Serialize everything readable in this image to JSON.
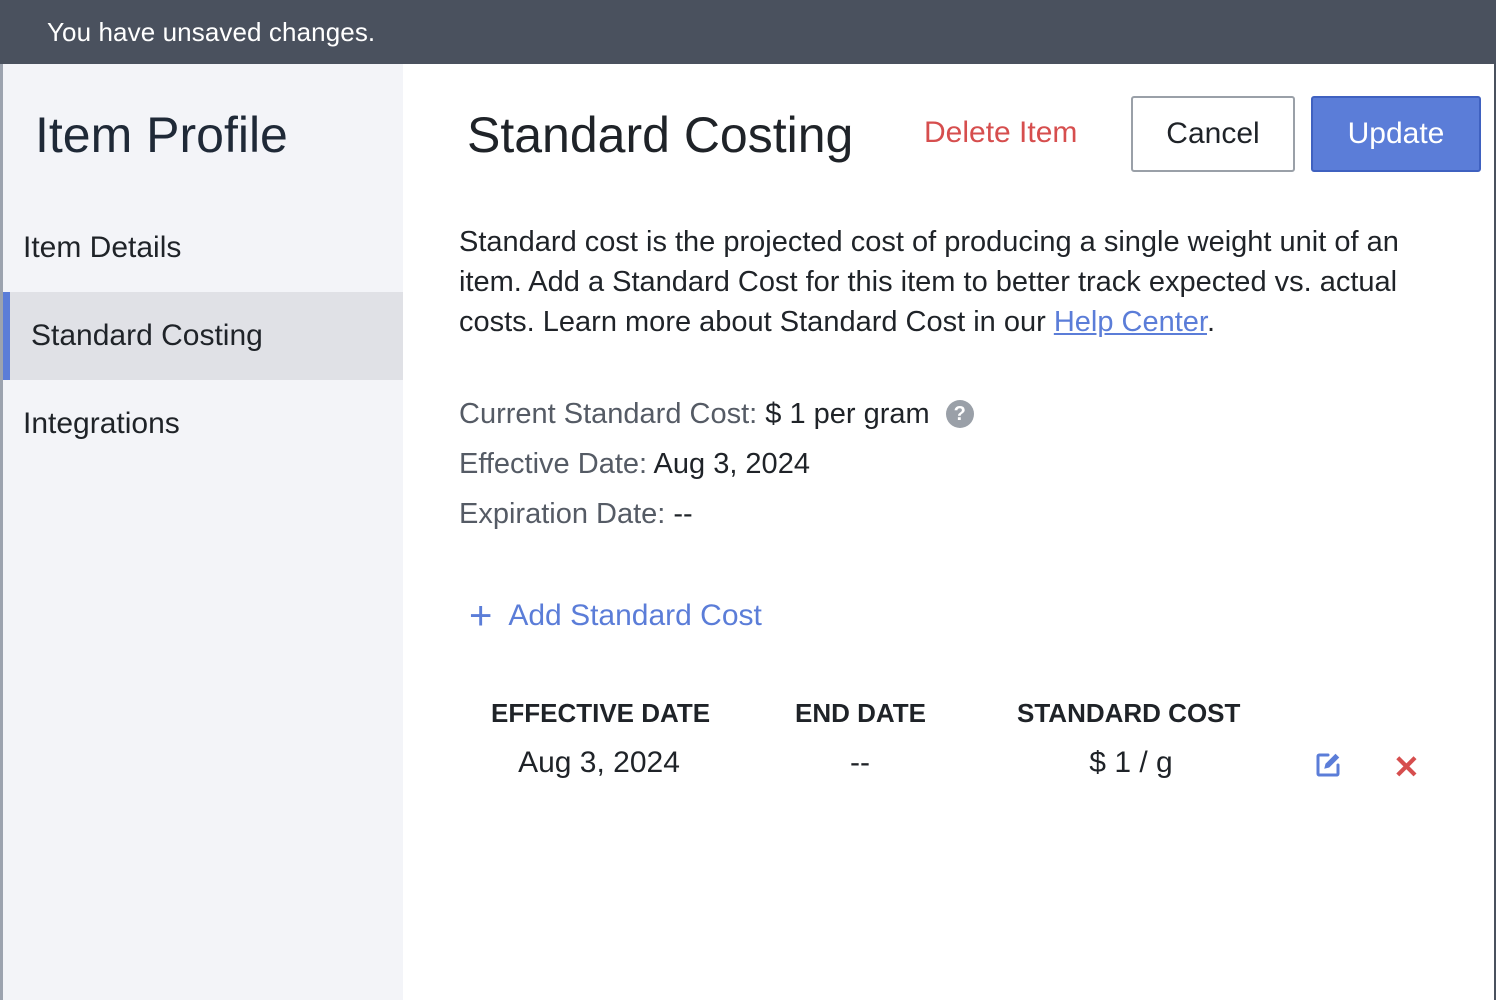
{
  "banner": {
    "message": "You have unsaved changes."
  },
  "sidebar": {
    "title": "Item Profile",
    "items": [
      {
        "label": "Item Details",
        "active": false
      },
      {
        "label": "Standard Costing",
        "active": true
      },
      {
        "label": "Integrations",
        "active": false
      }
    ]
  },
  "header": {
    "title": "Standard Costing",
    "delete_label": "Delete Item",
    "cancel_label": "Cancel",
    "update_label": "Update"
  },
  "description": {
    "text": "Standard cost is the projected cost of producing a single weight unit of an item. Add a Standard Cost for this item to better track expected vs. actual costs. Learn more about Standard Cost in our ",
    "link_text": "Help Center",
    "suffix": "."
  },
  "current": {
    "cost_label": "Current Standard Cost:",
    "cost_value": "$ 1 per gram",
    "effective_label": "Effective Date:",
    "effective_value": "Aug 3, 2024",
    "expiration_label": "Expiration Date:",
    "expiration_value": "--",
    "help_icon": "?"
  },
  "add_cost": {
    "icon": "+",
    "label": "Add Standard Cost"
  },
  "table": {
    "columns": [
      "EFFECTIVE DATE",
      "END DATE",
      "STANDARD COST"
    ],
    "rows": [
      {
        "effective_date": "Aug 3, 2024",
        "end_date": "--",
        "standard_cost": "$ 1 / g"
      }
    ]
  },
  "colors": {
    "accent": "#5b7dd8",
    "danger": "#d64e4e",
    "banner_bg": "#4a515e",
    "sidebar_bg": "#f3f4f8",
    "sidebar_active_bg": "#e0e1e6"
  },
  "icons": {
    "edit": "edit-icon",
    "remove": "close-icon",
    "help": "question-circle-icon",
    "add": "plus-icon"
  }
}
